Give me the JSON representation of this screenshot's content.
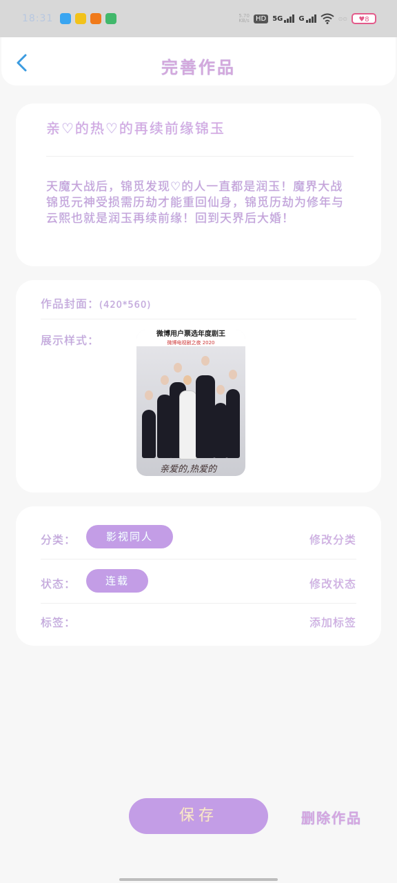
{
  "status_bar": {
    "time": "18:31",
    "network_speed": "5.70\nKB/s",
    "hd_label": "HD",
    "signal_1": "5G",
    "signal_2": "G",
    "battery": "8"
  },
  "header": {
    "title": "完善作品"
  },
  "work": {
    "title": "亲♡的热♡的再续前缘锦玉",
    "description": "天魔大战后，锦觅发现♡的人一直都是润玉！魔界大战锦觅元神受损需历劫才能重回仙身，锦觅历劫为修年与云熙也就是润玉再续前缘！回到天界后大婚！"
  },
  "cover_section": {
    "label": "作品封面：",
    "size_hint": "(420*560)",
    "style_label": "展示样式：",
    "poster_banner": "微博用户票选年度剧王",
    "poster_sub": "微博电视剧之夜 2020",
    "poster_caption": "亲爱的,热爱的"
  },
  "meta": {
    "category_label": "分类：",
    "category_value": "影视同人",
    "category_action": "修改分类",
    "status_label": "状态：",
    "status_value": "连载",
    "status_action": "修改状态",
    "tags_label": "标签：",
    "tags_action": "添加标签"
  },
  "actions": {
    "save": "保存",
    "delete": "删除作品"
  }
}
